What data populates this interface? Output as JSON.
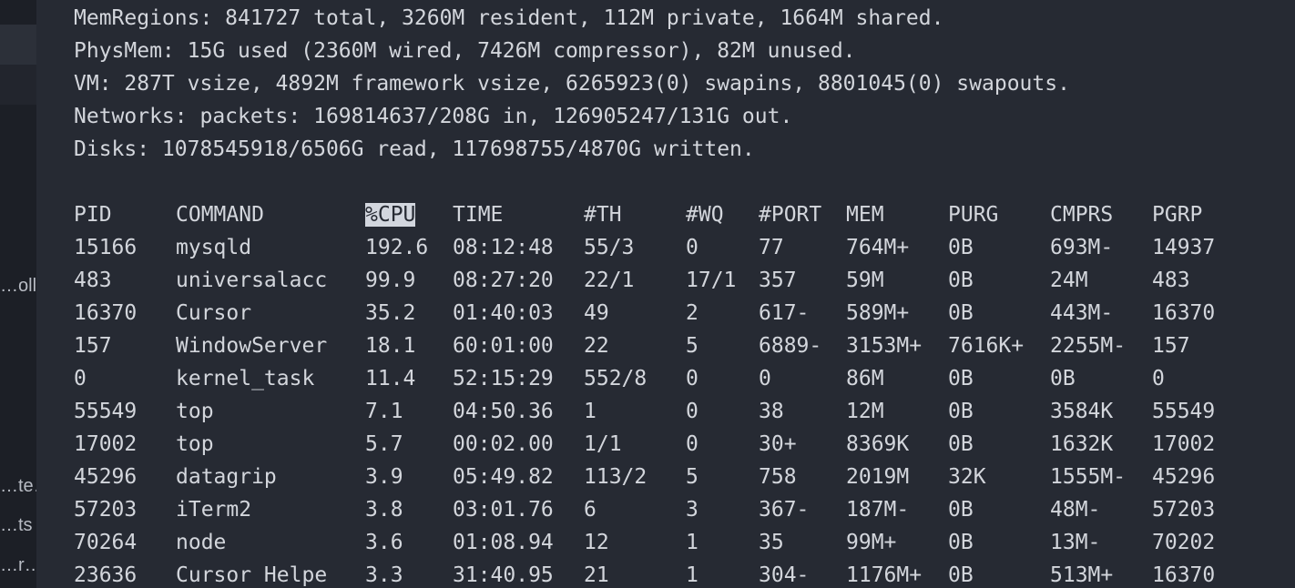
{
  "sidebar": {
    "items": [
      "…oll…",
      "…te…",
      "…ts",
      "…r…"
    ]
  },
  "summary": [
    "MemRegions: 841727 total, 3260M resident, 112M private, 1664M shared.",
    "PhysMem: 15G used (2360M wired, 7426M compressor), 82M unused.",
    "VM: 287T vsize, 4892M framework vsize, 6265923(0) swapins, 8801045(0) swapouts.",
    "Networks: packets: 169814637/208G in, 126905247/131G out.",
    "Disks: 1078545918/6506G read, 117698755/4870G written."
  ],
  "table": {
    "sorted_column": "%CPU",
    "headers": [
      "PID",
      "COMMAND",
      "%CPU",
      "TIME",
      "#TH",
      "#WQ",
      "#PORT",
      "MEM",
      "PURG",
      "CMPRS",
      "PGRP"
    ],
    "rows": [
      [
        "15166",
        "mysqld",
        "192.6",
        "08:12:48",
        "55/3",
        "0",
        "77",
        "764M+",
        "0B",
        "693M-",
        "14937"
      ],
      [
        "483",
        "universalacc",
        "99.9",
        "08:27:20",
        "22/1",
        "17/1",
        "357",
        "59M",
        "0B",
        "24M",
        "483"
      ],
      [
        "16370",
        "Cursor",
        "35.2",
        "01:40:03",
        "49",
        "2",
        "617-",
        "589M+",
        "0B",
        "443M-",
        "16370"
      ],
      [
        "157",
        "WindowServer",
        "18.1",
        "60:01:00",
        "22",
        "5",
        "6889-",
        "3153M+",
        "7616K+",
        "2255M-",
        "157"
      ],
      [
        "0",
        "kernel_task",
        "11.4",
        "52:15:29",
        "552/8",
        "0",
        "0",
        "86M",
        "0B",
        "0B",
        "0"
      ],
      [
        "55549",
        "top",
        "7.1",
        "04:50.36",
        "1",
        "0",
        "38",
        "12M",
        "0B",
        "3584K",
        "55549"
      ],
      [
        "17002",
        "top",
        "5.7",
        "00:02.00",
        "1/1",
        "0",
        "30+",
        "8369K",
        "0B",
        "1632K",
        "17002"
      ],
      [
        "45296",
        "datagrip",
        "3.9",
        "05:49.82",
        "113/2",
        "5",
        "758",
        "2019M",
        "32K",
        "1555M-",
        "45296"
      ],
      [
        "57203",
        "iTerm2",
        "3.8",
        "03:01.76",
        "6",
        "3",
        "367-",
        "187M-",
        "0B",
        "48M-",
        "57203"
      ],
      [
        "70264",
        "node",
        "3.6",
        "01:08.94",
        "12",
        "1",
        "35",
        "99M+",
        "0B",
        "13M-",
        "70202"
      ],
      [
        "23636",
        "Cursor Helpe",
        "3.3",
        "31:40.95",
        "21",
        "1",
        "304-",
        "1176M+",
        "0B",
        "513M+",
        "16370"
      ]
    ]
  }
}
